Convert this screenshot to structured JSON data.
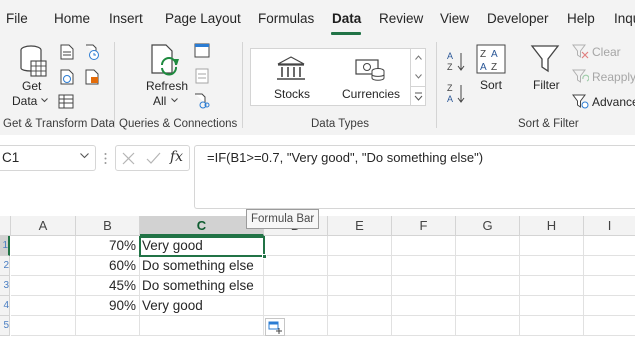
{
  "tabs": [
    "File",
    "Home",
    "Insert",
    "Page Layout",
    "Formulas",
    "Data",
    "Review",
    "View",
    "Developer",
    "Help",
    "Inqu"
  ],
  "active_tab": "Data",
  "ribbon": {
    "get_data": {
      "line1": "Get",
      "line2": "Data"
    },
    "refresh_all": {
      "line1": "Refresh",
      "line2": "All"
    },
    "data_types": {
      "stocks": "Stocks",
      "currencies": "Currencies"
    },
    "sort": "Sort",
    "filter": "Filter",
    "clear": "Clear",
    "reapply": "Reapply",
    "advanced": "Advanced",
    "groups": {
      "get_transform": "Get & Transform Data",
      "queries": "Queries & Connections",
      "data_types": "Data Types",
      "sort_filter": "Sort & Filter"
    }
  },
  "formula_bar": {
    "name_box": "C1",
    "fx": "fx",
    "formula": "=IF(B1>=0.7, \"Very good\", \"Do something else\")",
    "tooltip": "Formula Bar"
  },
  "grid": {
    "columns": [
      "A",
      "B",
      "C",
      "D",
      "E",
      "F",
      "G",
      "H",
      "I"
    ],
    "row_numbers": [
      "1",
      "2",
      "3",
      "4",
      "5"
    ],
    "rows": [
      {
        "b": "70%",
        "c": "Very good"
      },
      {
        "b": "60%",
        "c": "Do something else"
      },
      {
        "b": "45%",
        "c": "Do something else"
      },
      {
        "b": "90%",
        "c": "Very good"
      }
    ],
    "selected_cell": "C1"
  },
  "colors": {
    "accent": "#217346",
    "ribbon_bg": "#f3f3f3",
    "disabled_text": "#a6a6a6"
  }
}
